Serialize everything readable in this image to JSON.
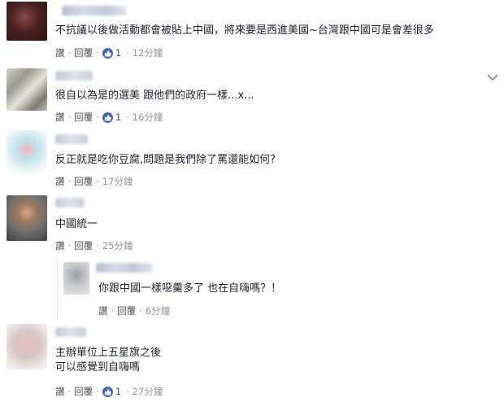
{
  "comments": [
    {
      "text_lines": [
        "不抗議以後做活動都會被貼上中國，將來要是西進美國~台灣跟中國可是會差很多"
      ],
      "actions": {
        "like": "讚",
        "reply": "回覆",
        "like_count": "1",
        "time": "12分鐘"
      }
    },
    {
      "text_lines": [
        "很自以為是的選美 跟他們的政府一樣...x..."
      ],
      "actions": {
        "like": "讚",
        "reply": "回覆",
        "like_count": "1",
        "time": "16分鐘"
      }
    },
    {
      "text_lines": [
        "反正就是吃你豆腐,問題是我們除了罵還能如何?"
      ],
      "actions": {
        "like": "讚",
        "reply": "回覆",
        "time": "17分鐘"
      }
    },
    {
      "text_lines": [
        "中國統一"
      ],
      "actions": {
        "like": "讚",
        "reply": "回覆",
        "time": "25分鐘"
      }
    },
    {
      "text_lines": [
        "你跟中國一樣噁羹多了 也在自嗨嗎？！"
      ],
      "actions": {
        "like": "讚",
        "reply": "回覆",
        "time": "6分鐘"
      }
    },
    {
      "text_lines": [
        "主辦單位上五星旗之後",
        "可以感覺到自嗨嗎"
      ],
      "actions": {
        "like": "讚",
        "reply": "回覆",
        "like_count": "1",
        "time": "27分鐘"
      }
    }
  ],
  "icons": {
    "like_badge": "thumbs-up-icon",
    "options": "chevron-down-icon"
  },
  "colors": {
    "like_badge": "#4267b2",
    "text": "#1d2129",
    "meta": "#90949c"
  }
}
